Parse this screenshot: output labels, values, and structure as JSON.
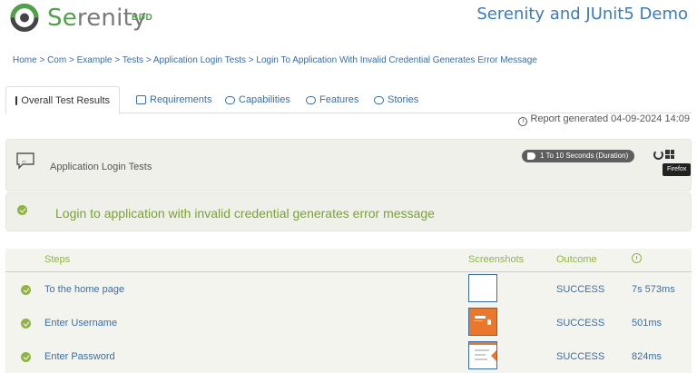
{
  "header": {
    "brand_prefix": "Se",
    "brand_rest": "renity",
    "brand_suffix": "BDD",
    "title": "Serenity and JUnit5 Demo"
  },
  "breadcrumb": "Home > Com > Example > Tests > Application Login Tests > Login To Application With Invalid Credential Generates Error Message",
  "tabs": [
    {
      "label": "Overall Test Results",
      "icon": "chart-icon",
      "active": true
    },
    {
      "label": "Requirements",
      "icon": "list-icon"
    },
    {
      "label": "Capabilities",
      "icon": "comment-icon"
    },
    {
      "label": "Features",
      "icon": "comment-icon"
    },
    {
      "label": "Stories",
      "icon": "comment-icon"
    }
  ],
  "report_generated": "Report generated 04-09-2024 14:09",
  "feature": {
    "name": "Application Login Tests",
    "tag": "1 To 10 Seconds (Duration)",
    "tooltip": "Firefox"
  },
  "scenario": {
    "title": "Login to application with invalid credential generates error message",
    "status": "success"
  },
  "steps_table": {
    "headers": {
      "steps": "Steps",
      "screenshots": "Screenshots",
      "outcome": "Outcome",
      "duration": "clock-icon"
    },
    "rows": [
      {
        "description": "To the home page",
        "outcome": "SUCCESS",
        "duration": "7s 573ms",
        "screenshot": "blank-page"
      },
      {
        "description": "Enter Username",
        "outcome": "SUCCESS",
        "duration": "501ms",
        "screenshot": "orange-page"
      },
      {
        "description": "Enter Password",
        "outcome": "SUCCESS",
        "duration": "824ms",
        "screenshot": "login-page"
      }
    ]
  },
  "colors": {
    "brand_green": "#51a14a",
    "link_blue": "#3a6ea5",
    "success_green": "#8fb443",
    "panel_bg": "#f0f0ea"
  }
}
